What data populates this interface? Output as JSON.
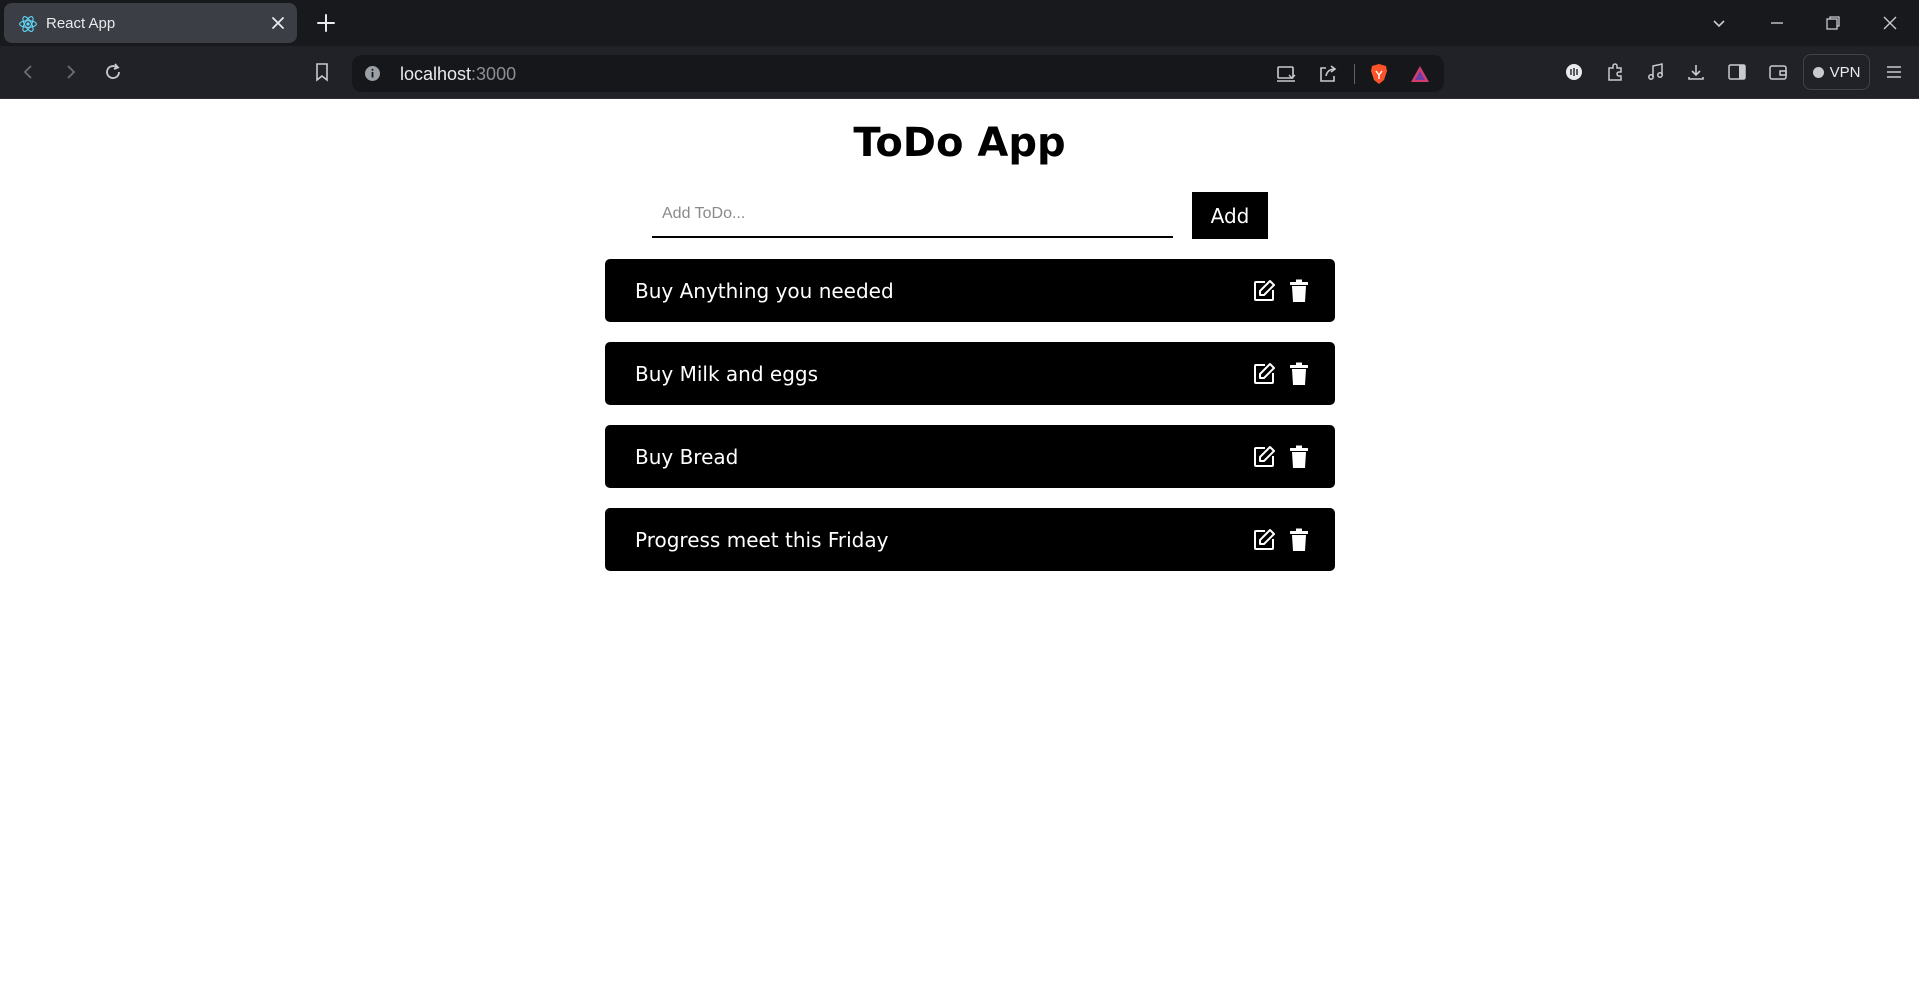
{
  "browser": {
    "tab": {
      "title": "React App",
      "favicon": "react-logo-icon"
    },
    "url": {
      "host": "localhost",
      "port": ":3000"
    },
    "vpn_label": "VPN"
  },
  "app": {
    "title": "ToDo App",
    "input": {
      "placeholder": "Add ToDo...",
      "value": ""
    },
    "add_label": "Add",
    "todos": [
      {
        "text": "Buy Anything you needed"
      },
      {
        "text": "Buy Milk and eggs"
      },
      {
        "text": "Buy Bread"
      },
      {
        "text": "Progress meet this Friday"
      }
    ]
  },
  "colors": {
    "page_bg": "#ffffff",
    "item_bg": "#000000",
    "item_text": "#ffffff",
    "chrome_bg": "#17191d",
    "toolbar_bg": "#202227"
  }
}
